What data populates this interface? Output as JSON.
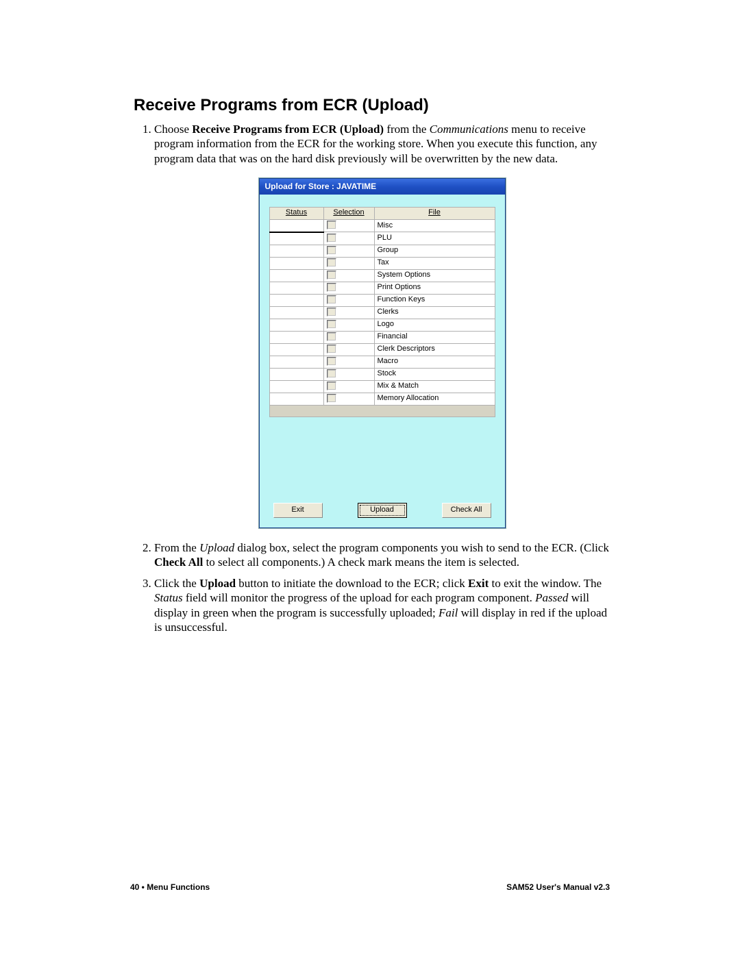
{
  "heading": "Receive Programs from ECR (Upload)",
  "step1": {
    "pre": "Choose ",
    "bold": "Receive Programs from ECR (Upload)",
    "mid": " from the ",
    "ital": "Communications",
    "post": " menu to receive program information from the ECR for the working store.  When you execute this function, any program data that was on the hard disk previously will be overwritten by the new data."
  },
  "dialog": {
    "title": "Upload for Store : JAVATIME",
    "headers": {
      "status": "Status",
      "selection": "Selection",
      "file": "File"
    },
    "files": [
      "Misc",
      "PLU",
      "Group",
      "Tax",
      "System Options",
      "Print Options",
      "Function Keys",
      "Clerks",
      "Logo",
      "Financial",
      "Clerk Descriptors",
      "Macro",
      "Stock",
      "Mix & Match",
      "Memory Allocation"
    ],
    "buttons": {
      "exit": "Exit",
      "upload": "Upload",
      "checkall": "Check All"
    }
  },
  "step2": {
    "t0": "From the ",
    "i1": "Upload",
    "t1": " dialog box, select the program components you wish to send to the ECR.  (Click ",
    "b1": "Check All",
    "t2": " to select all components.)  A check mark means the item is selected."
  },
  "step3": {
    "t0": "Click the ",
    "b1": "Upload",
    "t1": " button to initiate the download to the ECR; click ",
    "b2": "Exit",
    "t2": " to exit the window.  The ",
    "i1": "Status",
    "t3": " field will monitor the progress of the upload for each program component.  ",
    "i2": "Passed",
    "t4": " will display in green when the program is successfully uploaded; ",
    "i3": "Fail",
    "t5": " will display in red if the upload is unsuccessful."
  },
  "footer": {
    "left": "40  •  Menu Functions",
    "right": "SAM52 User's Manual v2.3"
  }
}
